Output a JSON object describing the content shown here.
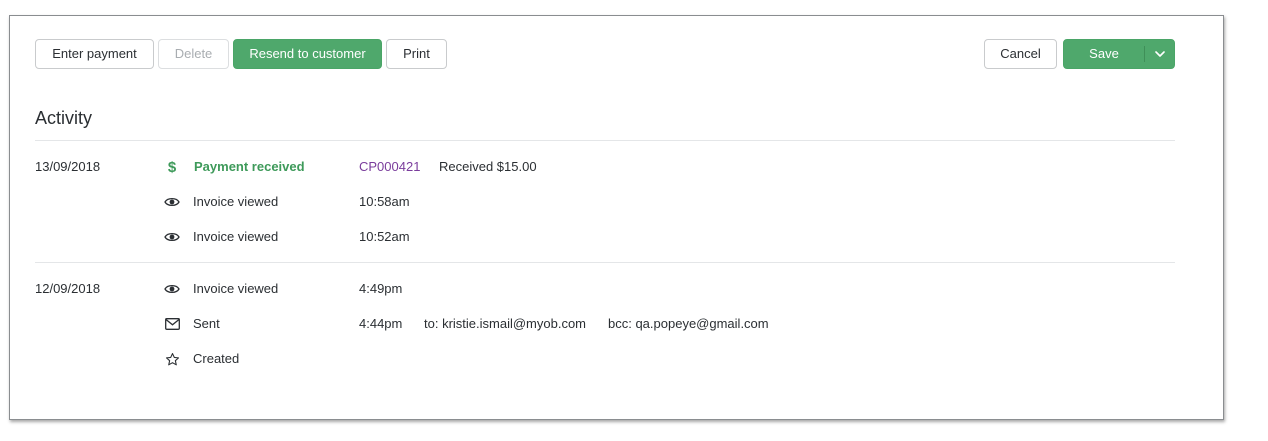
{
  "toolbar": {
    "enter_payment": "Enter payment",
    "delete": "Delete",
    "resend": "Resend to customer",
    "print": "Print",
    "cancel": "Cancel",
    "save": "Save"
  },
  "activity": {
    "title": "Activity",
    "groups": [
      {
        "date": "13/09/2018",
        "events": [
          {
            "icon": "dollar-icon",
            "label": "Payment received",
            "link": "CP000421",
            "detail": "Received $15.00"
          },
          {
            "icon": "eye-icon",
            "label": "Invoice viewed",
            "time": "10:58am"
          },
          {
            "icon": "eye-icon",
            "label": "Invoice viewed",
            "time": "10:52am"
          }
        ]
      },
      {
        "date": "12/09/2018",
        "events": [
          {
            "icon": "eye-icon",
            "label": "Invoice viewed",
            "time": "4:49pm"
          },
          {
            "icon": "envelope-icon",
            "label": "Sent",
            "time": "4:44pm",
            "to": "to: kristie.ismail@myob.com",
            "bcc": "bcc: qa.popeye@gmail.com"
          },
          {
            "icon": "star-icon",
            "label": "Created"
          }
        ]
      }
    ]
  },
  "colors": {
    "primary_green": "#4fa86c",
    "success_text": "#3e9a5a",
    "link_purple": "#7a3d9c",
    "border": "#c9cbcd",
    "disabled_text": "#a9adb1"
  }
}
